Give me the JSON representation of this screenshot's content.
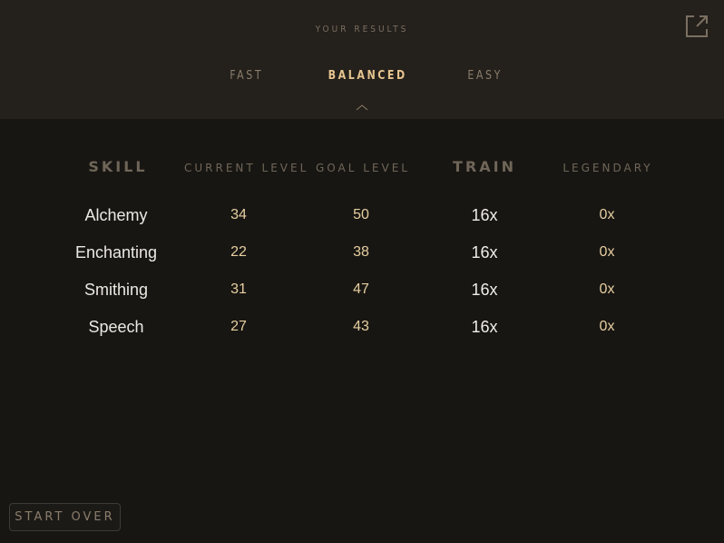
{
  "header": {
    "title": "YOUR RESULTS",
    "export_icon": "external-link-icon"
  },
  "tabs": [
    {
      "label": "FAST",
      "active": false
    },
    {
      "label": "BALANCED",
      "active": true
    },
    {
      "label": "EASY",
      "active": false
    }
  ],
  "table": {
    "columns": [
      "SKILL",
      "CURRENT LEVEL",
      "GOAL LEVEL",
      "TRAIN",
      "LEGENDARY"
    ],
    "rows": [
      {
        "skill": "Alchemy",
        "current": "34",
        "goal": "50",
        "train": "16x",
        "legendary": "0x"
      },
      {
        "skill": "Enchanting",
        "current": "22",
        "goal": "38",
        "train": "16x",
        "legendary": "0x"
      },
      {
        "skill": "Smithing",
        "current": "31",
        "goal": "47",
        "train": "16x",
        "legendary": "0x"
      },
      {
        "skill": "Speech",
        "current": "27",
        "goal": "43",
        "train": "16x",
        "legendary": "0x"
      }
    ]
  },
  "footer": {
    "start_over_label": "START OVER"
  },
  "colors": {
    "background": "#181613",
    "header_background": "#24201c",
    "accent": "#e6c48f",
    "muted": "#7a6f61"
  }
}
